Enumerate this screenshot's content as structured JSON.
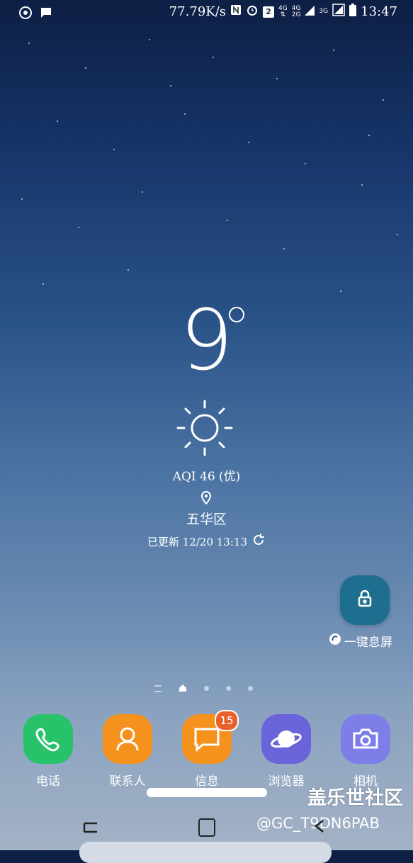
{
  "status_bar": {
    "net_speed": "77.79K/s",
    "sim_badge": "2",
    "net1_top": "4G",
    "net2_top": "4G",
    "net2_bottom": "2G",
    "net3": "3G",
    "time": "13:47",
    "icons": [
      "sync-icon",
      "chat-icon",
      "nfc-icon",
      "alarm-icon",
      "signal-icon",
      "battery-icon"
    ]
  },
  "weather": {
    "temperature": "9",
    "aqi": "AQI 46 (优)",
    "district": "五华区",
    "updated": "已更新 12/20 13:13",
    "condition_icon": "sun-icon"
  },
  "lock_widget": {
    "label": "一键息屏",
    "accent": "#1e6f8f"
  },
  "pager": {
    "pages": 4,
    "current": 0
  },
  "dock": {
    "apps": [
      {
        "label": "电话",
        "color": "#27c26a",
        "icon": "phone-icon"
      },
      {
        "label": "联系人",
        "color": "#f5921e",
        "icon": "contacts-icon"
      },
      {
        "label": "信息",
        "color": "#f5921e",
        "icon": "message-icon",
        "badge": "15"
      },
      {
        "label": "浏览器",
        "color": "#6b63d9",
        "icon": "browser-planet-icon"
      },
      {
        "label": "相机",
        "color": "#7d7ee8",
        "icon": "camera-icon"
      }
    ]
  },
  "watermark": {
    "title": "盖乐世社区",
    "user": "@GC_T9DN6PAB"
  }
}
